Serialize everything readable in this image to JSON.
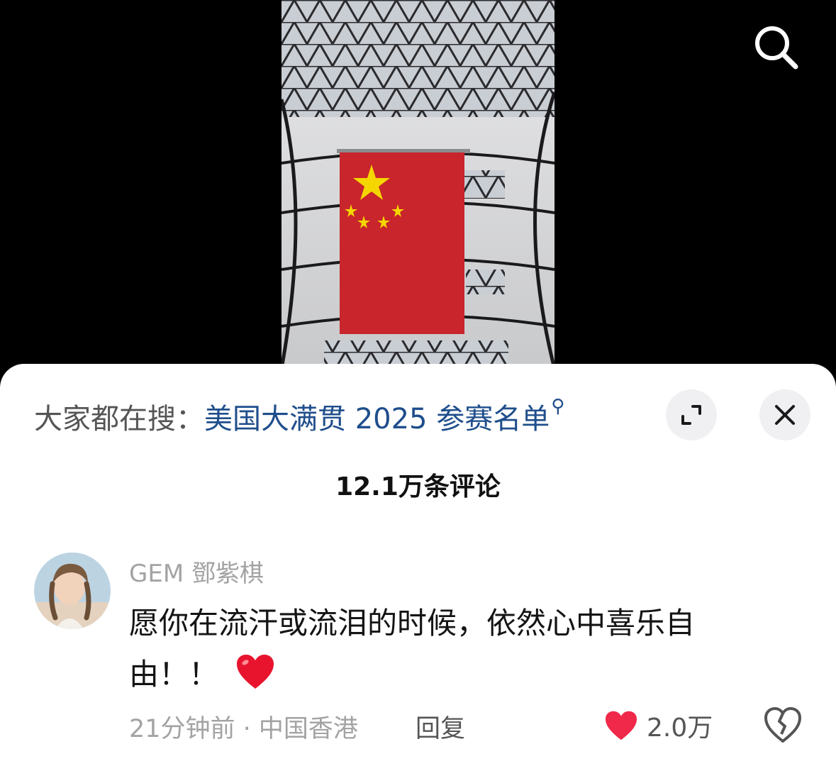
{
  "hot_search": {
    "prefix": "大家都在搜：",
    "query": "美国大满贯 2025 参赛名单",
    "query_icon": "small-search-icon"
  },
  "header": {
    "comment_count": "12.1万条评论"
  },
  "comment": {
    "username": "GEM 鄧紫棋",
    "text": "愿你在流汗或流泪的时候，依然心中喜乐自由！！",
    "emoji": "red-heart-emoji",
    "time_location": "21分钟前 · 中国香港",
    "reply_label": "回复",
    "like_count": "2.0万",
    "liked": true
  },
  "icons": {
    "search": "search-icon",
    "expand": "expand-icon",
    "close": "close-icon",
    "like": "heart-filled-icon",
    "dislike": "broken-heart-icon"
  },
  "colors": {
    "accent_link": "#1f4e8c",
    "like_red": "#f0284a",
    "flag_red": "#c8252c",
    "flag_star": "#f5d600"
  }
}
